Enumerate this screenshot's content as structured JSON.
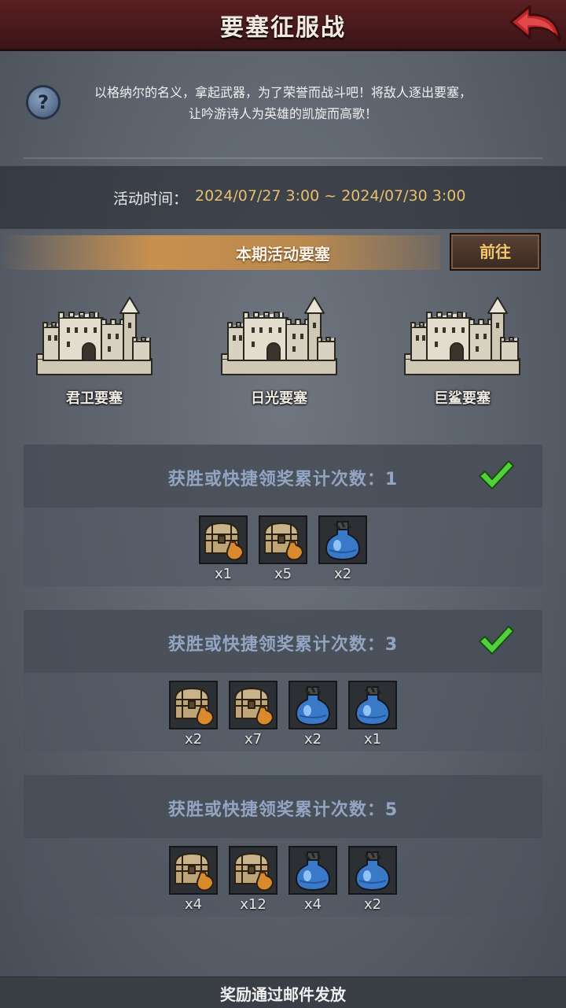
{
  "header": {
    "title": "要塞征服战"
  },
  "intro": {
    "line1": "以格纳尔的名义，拿起武器，为了荣誉而战斗吧！将敌人逐出要塞，",
    "line2": "让吟游诗人为英雄的凯旋而高歌！"
  },
  "event_time": {
    "label": "活动时间：",
    "value": "2024/07/27 3:00 ~ 2024/07/30 3:00"
  },
  "active_forts": {
    "title": "本期活动要塞",
    "goto_label": "前往",
    "forts": [
      {
        "name": "君卫要塞"
      },
      {
        "name": "日光要塞"
      },
      {
        "name": "巨鲨要塞"
      }
    ]
  },
  "reward_tiers": [
    {
      "title": "获胜或快捷领奖累计次数：1",
      "completed": true,
      "items": [
        {
          "icon": "treasure-chest-icon",
          "count": "x1"
        },
        {
          "icon": "treasure-chest-icon",
          "count": "x5"
        },
        {
          "icon": "blue-potion-icon",
          "count": "x2"
        }
      ]
    },
    {
      "title": "获胜或快捷领奖累计次数：3",
      "completed": true,
      "items": [
        {
          "icon": "treasure-chest-icon",
          "count": "x2"
        },
        {
          "icon": "treasure-chest-icon",
          "count": "x7"
        },
        {
          "icon": "blue-potion-icon",
          "count": "x2"
        },
        {
          "icon": "blue-potion-icon",
          "count": "x1"
        }
      ]
    },
    {
      "title": "获胜或快捷领奖累计次数：5",
      "completed": false,
      "items": [
        {
          "icon": "treasure-chest-icon",
          "count": "x4"
        },
        {
          "icon": "treasure-chest-icon",
          "count": "x12"
        },
        {
          "icon": "blue-potion-icon",
          "count": "x4"
        },
        {
          "icon": "blue-potion-icon",
          "count": "x2"
        }
      ]
    }
  ],
  "footer": {
    "text": "奖励通过邮件发放"
  },
  "colors": {
    "header_bg": "#4a1a1c",
    "accent_gold": "#e9be6d",
    "tier_title": "#93a5c2",
    "check_green": "#4fd13a"
  }
}
